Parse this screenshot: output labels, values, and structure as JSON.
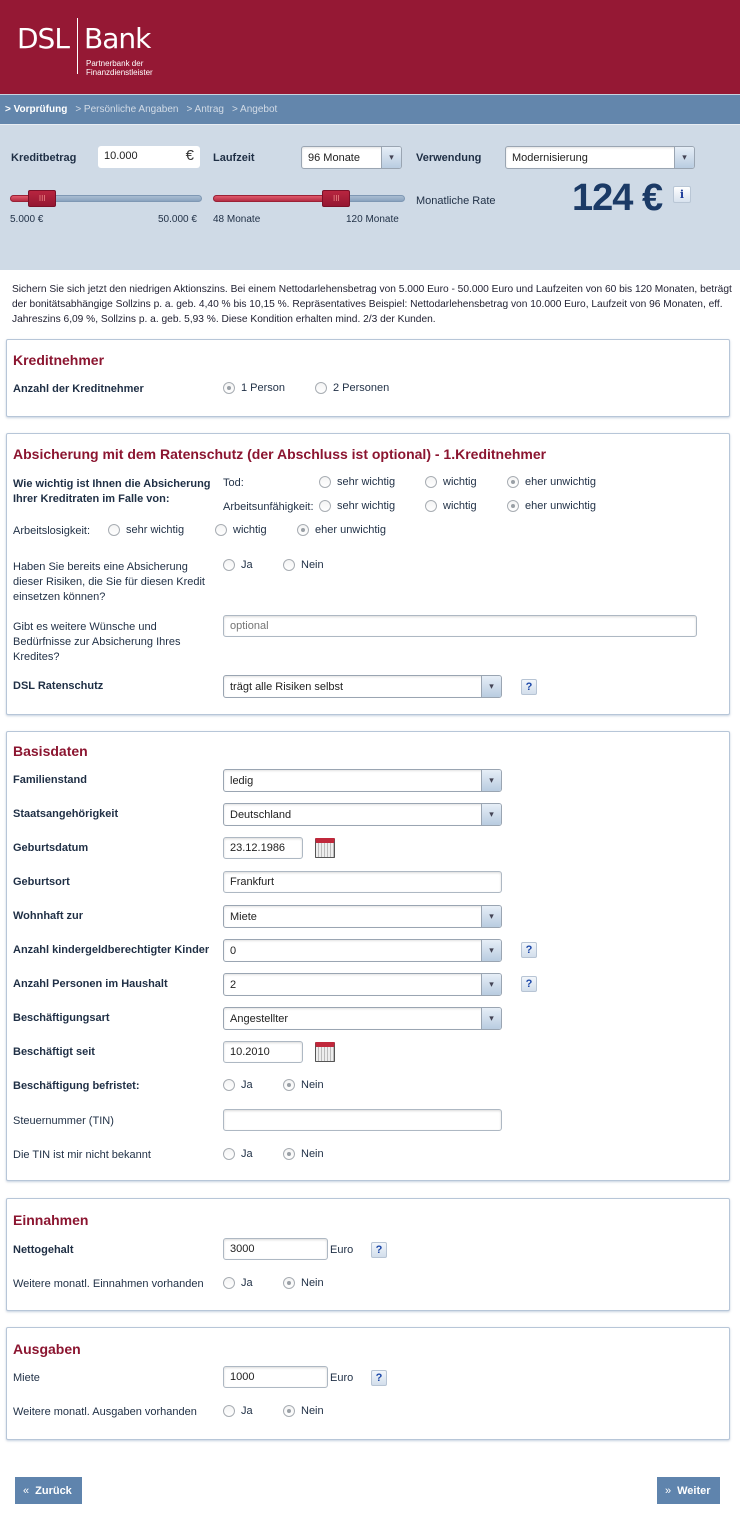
{
  "header": {
    "logo_left": "DSL",
    "logo_right": "Bank",
    "logo_tagline": "Partnerbank der Finanzdienstleister",
    "brand_color": "#951834"
  },
  "nav": {
    "steps": [
      {
        "label": "> Vorprüfung",
        "active": true
      },
      {
        "label": "> Persönliche Angaben",
        "active": false
      },
      {
        "label": "> Antrag",
        "active": false
      },
      {
        "label": "> Angebot",
        "active": false
      }
    ]
  },
  "calculator": {
    "kreditbetrag_label": "Kreditbetrag",
    "kreditbetrag_value": "10.000",
    "currency_symbol": "€",
    "laufzeit_label": "Laufzeit",
    "laufzeit_value": "96 Monate",
    "verwendung_label": "Verwendung",
    "verwendung_value": "Modernisierung",
    "amount_slider": {
      "min_label": "5.000 €",
      "max_label": "50.000 €",
      "min": 5000,
      "max": 50000,
      "value": 10000
    },
    "term_slider": {
      "min_label": "48 Monate",
      "max_label": "120 Monate",
      "min": 48,
      "max": 120,
      "value": 96
    },
    "rate_label": "Monatliche Rate",
    "rate_value": "124 €",
    "info_icon": "i"
  },
  "disclaimer": "Sichern Sie sich jetzt den niedrigen Aktionszins. Bei einem Nettodarlehensbetrag von 5.000 Euro - 50.000 Euro und Laufzeiten von 60 bis 120 Monaten, beträgt der bonitätsabhängige Sollzins p. a. geb. 4,40 % bis 10,15 %. Repräsentatives Beispiel: Nettodarlehensbetrag von 10.000 Euro, Laufzeit von 96 Monaten, eff. Jahreszins 6,09 %, Sollzins p. a. geb. 5,93 %. Diese Kondition erhalten mind. 2/3 der Kunden.",
  "kreditnehmer": {
    "title": "Kreditnehmer",
    "label": "Anzahl der Kreditnehmer",
    "options": [
      {
        "label": "1 Person",
        "checked": true
      },
      {
        "label": "2 Personen",
        "checked": false
      }
    ]
  },
  "absicherung": {
    "title": "Absicherung mit dem Ratenschutz (der Abschluss ist optional) - 1.Kreditnehmer",
    "question": "Wie wichtig ist Ihnen die Absicherung Ihrer Kreditraten im Falle von:",
    "rows": [
      {
        "label": "Tod:",
        "options": [
          {
            "label": "sehr wichtig",
            "checked": false
          },
          {
            "label": "wichtig",
            "checked": false
          },
          {
            "label": "eher unwichtig",
            "checked": true
          }
        ]
      },
      {
        "label": "Arbeitsunfähigkeit:",
        "options": [
          {
            "label": "sehr wichtig",
            "checked": false
          },
          {
            "label": "wichtig",
            "checked": false
          },
          {
            "label": "eher unwichtig",
            "checked": true
          }
        ]
      },
      {
        "label": "Arbeitslosigkeit:",
        "options": [
          {
            "label": "sehr wichtig",
            "checked": false
          },
          {
            "label": "wichtig",
            "checked": false
          },
          {
            "label": "eher unwichtig",
            "checked": true
          }
        ]
      }
    ],
    "existing_label": "Haben Sie bereits eine Absicherung dieser Risiken, die Sie für diesen Kredit einsetzen können?",
    "existing_options": [
      {
        "label": "Ja",
        "checked": false
      },
      {
        "label": "Nein",
        "checked": false
      }
    ],
    "wishes_label": "Gibt es weitere Wünsche und Bedürfnisse zur Absicherung Ihres Kredites?",
    "wishes_placeholder": "optional",
    "ratenschutz_label": "DSL Ratenschutz",
    "ratenschutz_value": "trägt alle Risiken selbst"
  },
  "basisdaten": {
    "title": "Basisdaten",
    "familienstand_label": "Familienstand",
    "familienstand_value": "ledig",
    "staat_label": "Staatsangehörigkeit",
    "staat_value": "Deutschland",
    "geburtsdatum_label": "Geburtsdatum",
    "geburtsdatum_value": "23.12.1986",
    "geburtsort_label": "Geburtsort",
    "geburtsort_value": "Frankfurt",
    "wohnhaft_label": "Wohnhaft zur",
    "wohnhaft_value": "Miete",
    "kinder_label": "Anzahl kindergeldberechtigter Kinder",
    "kinder_value": "0",
    "personen_label": "Anzahl Personen im Haushalt",
    "personen_value": "2",
    "art_label": "Beschäftigungsart",
    "art_value": "Angestellter",
    "seit_label": "Beschäftigt seit",
    "seit_value": "10.2010",
    "befristet_label": "Beschäftigung befristet:",
    "befristet_options": [
      {
        "label": "Ja",
        "checked": false
      },
      {
        "label": "Nein",
        "checked": true
      }
    ],
    "tin_label": "Steuernummer (TIN)",
    "tin_value": "",
    "tin_unknown_label": "Die TIN ist mir nicht bekannt",
    "tin_unknown_options": [
      {
        "label": "Ja",
        "checked": false
      },
      {
        "label": "Nein",
        "checked": true
      }
    ]
  },
  "einnahmen": {
    "title": "Einnahmen",
    "netto_label": "Nettogehalt",
    "netto_value": "3000",
    "unit": "Euro",
    "weitere_label": "Weitere monatl. Einnahmen vorhanden",
    "weitere_options": [
      {
        "label": "Ja",
        "checked": false
      },
      {
        "label": "Nein",
        "checked": true
      }
    ]
  },
  "ausgaben": {
    "title": "Ausgaben",
    "miete_label": "Miete",
    "miete_value": "1000",
    "unit": "Euro",
    "weitere_label": "Weitere monatl. Ausgaben vorhanden",
    "weitere_options": [
      {
        "label": "Ja",
        "checked": false
      },
      {
        "label": "Nein",
        "checked": true
      }
    ]
  },
  "footer": {
    "back_label": "Zurück",
    "back_icon": "«",
    "next_label": "Weiter",
    "next_icon": "»"
  },
  "help_icon": "?",
  "select_arrow": "▾"
}
